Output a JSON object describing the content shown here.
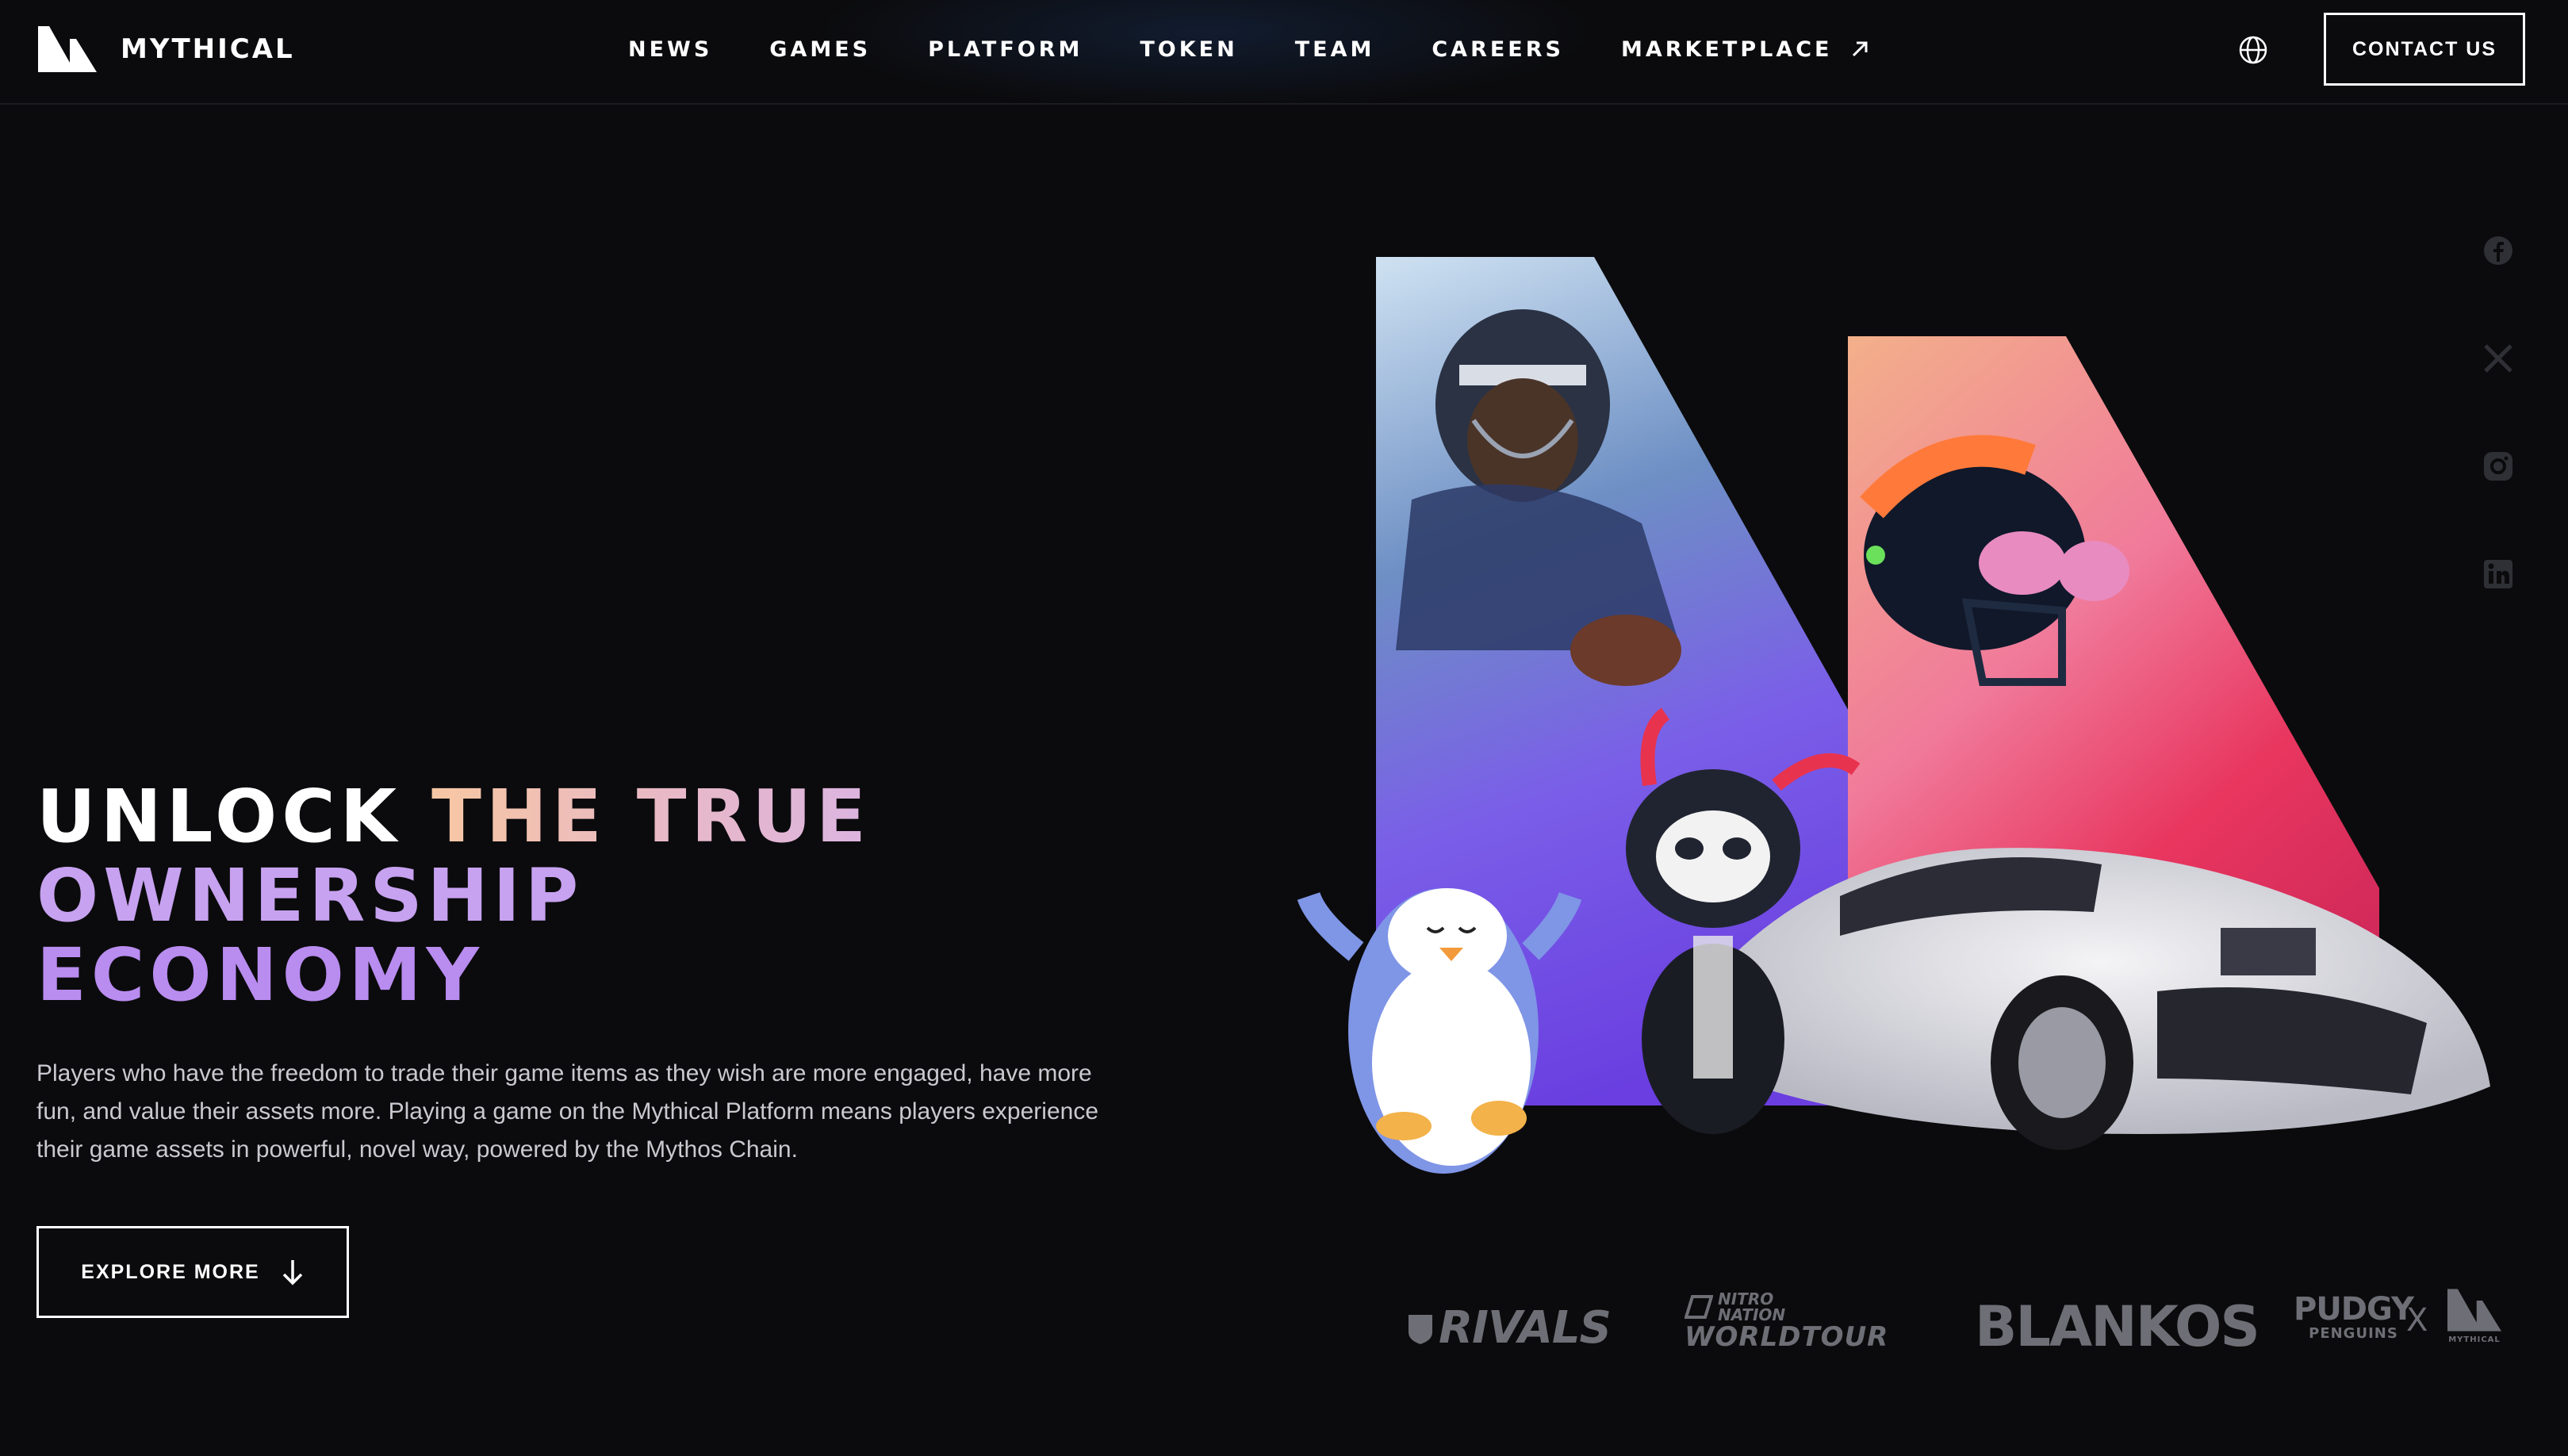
{
  "brand": {
    "name": "MYTHICAL",
    "logo_icon": "mythical-m-logo"
  },
  "nav": {
    "items": [
      {
        "label": "NEWS"
      },
      {
        "label": "GAMES"
      },
      {
        "label": "PLATFORM"
      },
      {
        "label": "TOKEN"
      },
      {
        "label": "TEAM"
      },
      {
        "label": "CAREERS"
      },
      {
        "label": "MARKETPLACE",
        "icon": "external-link-icon"
      }
    ],
    "language_icon": "globe-icon",
    "contact_label": "CONTACT US"
  },
  "hero": {
    "headline": {
      "line1_a": "UNLOCK ",
      "line1_b": "THE TRUE",
      "line2": "OWNERSHIP",
      "line3": "ECONOMY"
    },
    "body": "Players who have the freedom to trade their game items as they wish are more engaged, have more fun, and value their assets more. Playing a game on the Mythical Platform means players experience their game assets in powerful, novel way, powered by the Mythos Chain.",
    "cta_label": "EXPLORE MORE",
    "cta_icon": "arrow-down-icon"
  },
  "social": [
    "facebook-icon",
    "x-icon",
    "instagram-icon",
    "linkedin-icon"
  ],
  "partners": {
    "rivals": "RIVALS",
    "nitro_top": "NITRO",
    "nitro_mid": "NATION",
    "nitro_bottom": "WORLDTOUR",
    "blankos": "BLANKOS",
    "pudgy_top": "PUDGY",
    "pudgy_bottom": "PENGUINS",
    "cross": "X",
    "mythical_small": "MYTHICAL"
  },
  "colors": {
    "background": "#0b0b0d",
    "headline_peach": "#f7c7a3",
    "headline_purple": "#c7a2f0",
    "text_muted": "#c9c9cf"
  }
}
